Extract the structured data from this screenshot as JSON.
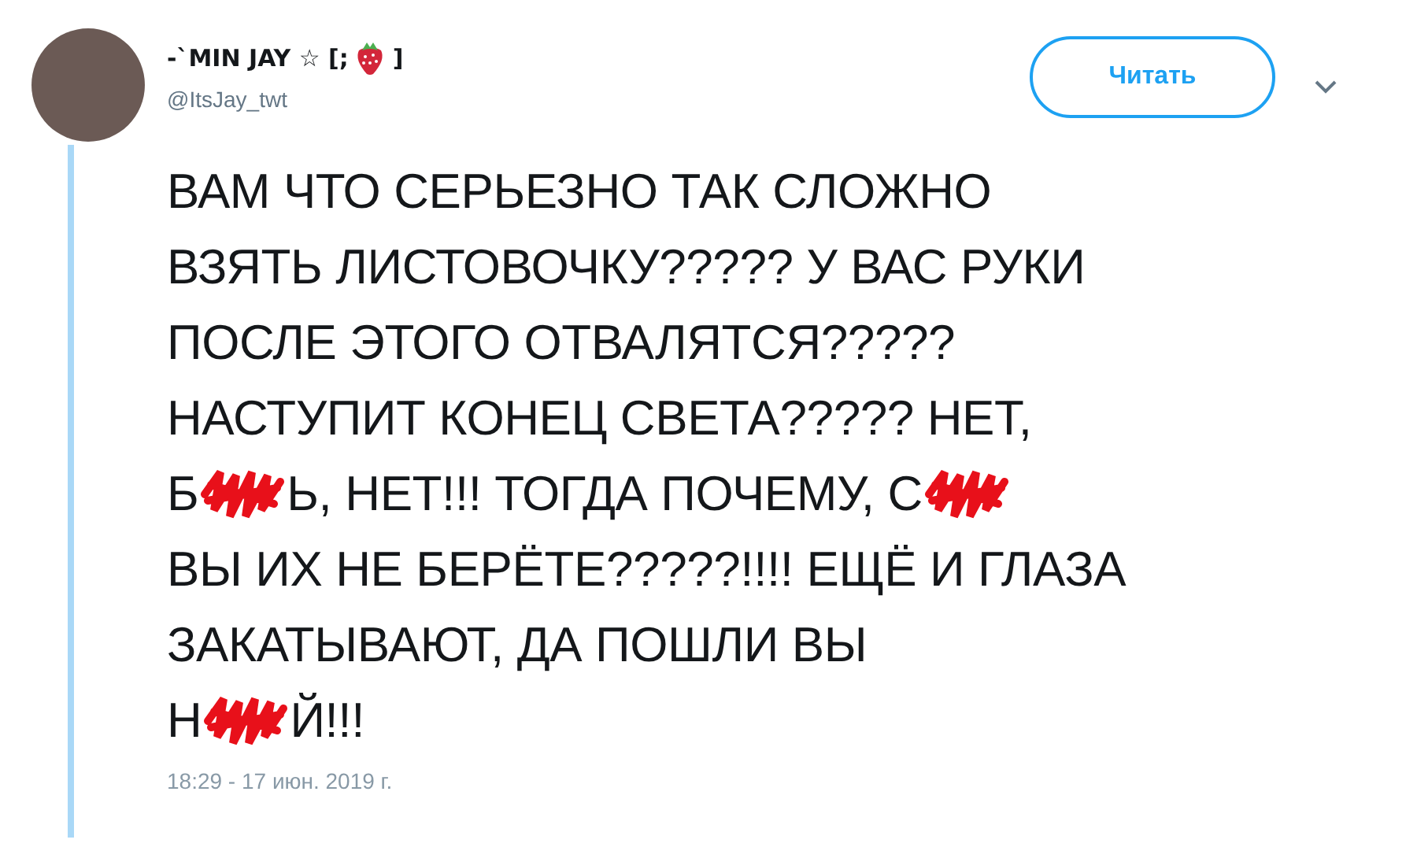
{
  "author": {
    "name": "-`MIN JAY ☆ [;",
    "name_end": "]",
    "handle": "@ItsJay_twt"
  },
  "follow_button": {
    "label": "Читать"
  },
  "text_lines": [
    [
      {
        "kind": "text",
        "text": "ВАМ ЧТО СЕРЬЕЗНО ТАК СЛОЖНО"
      }
    ],
    [
      {
        "kind": "text",
        "text": "ВЗЯТЬ ЛИСТОВОЧКУ????? У ВАС РУКИ"
      }
    ],
    [
      {
        "kind": "text",
        "text": "ПОСЛЕ ЭТОГО ОТВАЛЯТСЯ?????"
      }
    ],
    [
      {
        "kind": "text",
        "text": "НАСТУПИТ КОНЕЦ СВЕТА????? НЕТ,"
      }
    ],
    [
      {
        "kind": "text",
        "text": "Б"
      },
      {
        "kind": "redaction"
      },
      {
        "kind": "text",
        "text": "Ь, НЕТ!!! ТОГДА ПОЧЕМУ, С"
      },
      {
        "kind": "redaction"
      }
    ],
    [
      {
        "kind": "text",
        "text": "ВЫ ИХ НЕ БЕРЁТЕ?????!!!! ЕЩЁ И ГЛАЗА"
      }
    ],
    [
      {
        "kind": "text",
        "text": "ЗАКАТЫВАЮТ, ДА ПОШЛИ ВЫ"
      }
    ],
    [
      {
        "kind": "text",
        "text": "Н"
      },
      {
        "kind": "redaction"
      },
      {
        "kind": "text",
        "text": "Й!!!"
      }
    ]
  ],
  "timestamp": "18:29 - 17 июн. 2019 г."
}
